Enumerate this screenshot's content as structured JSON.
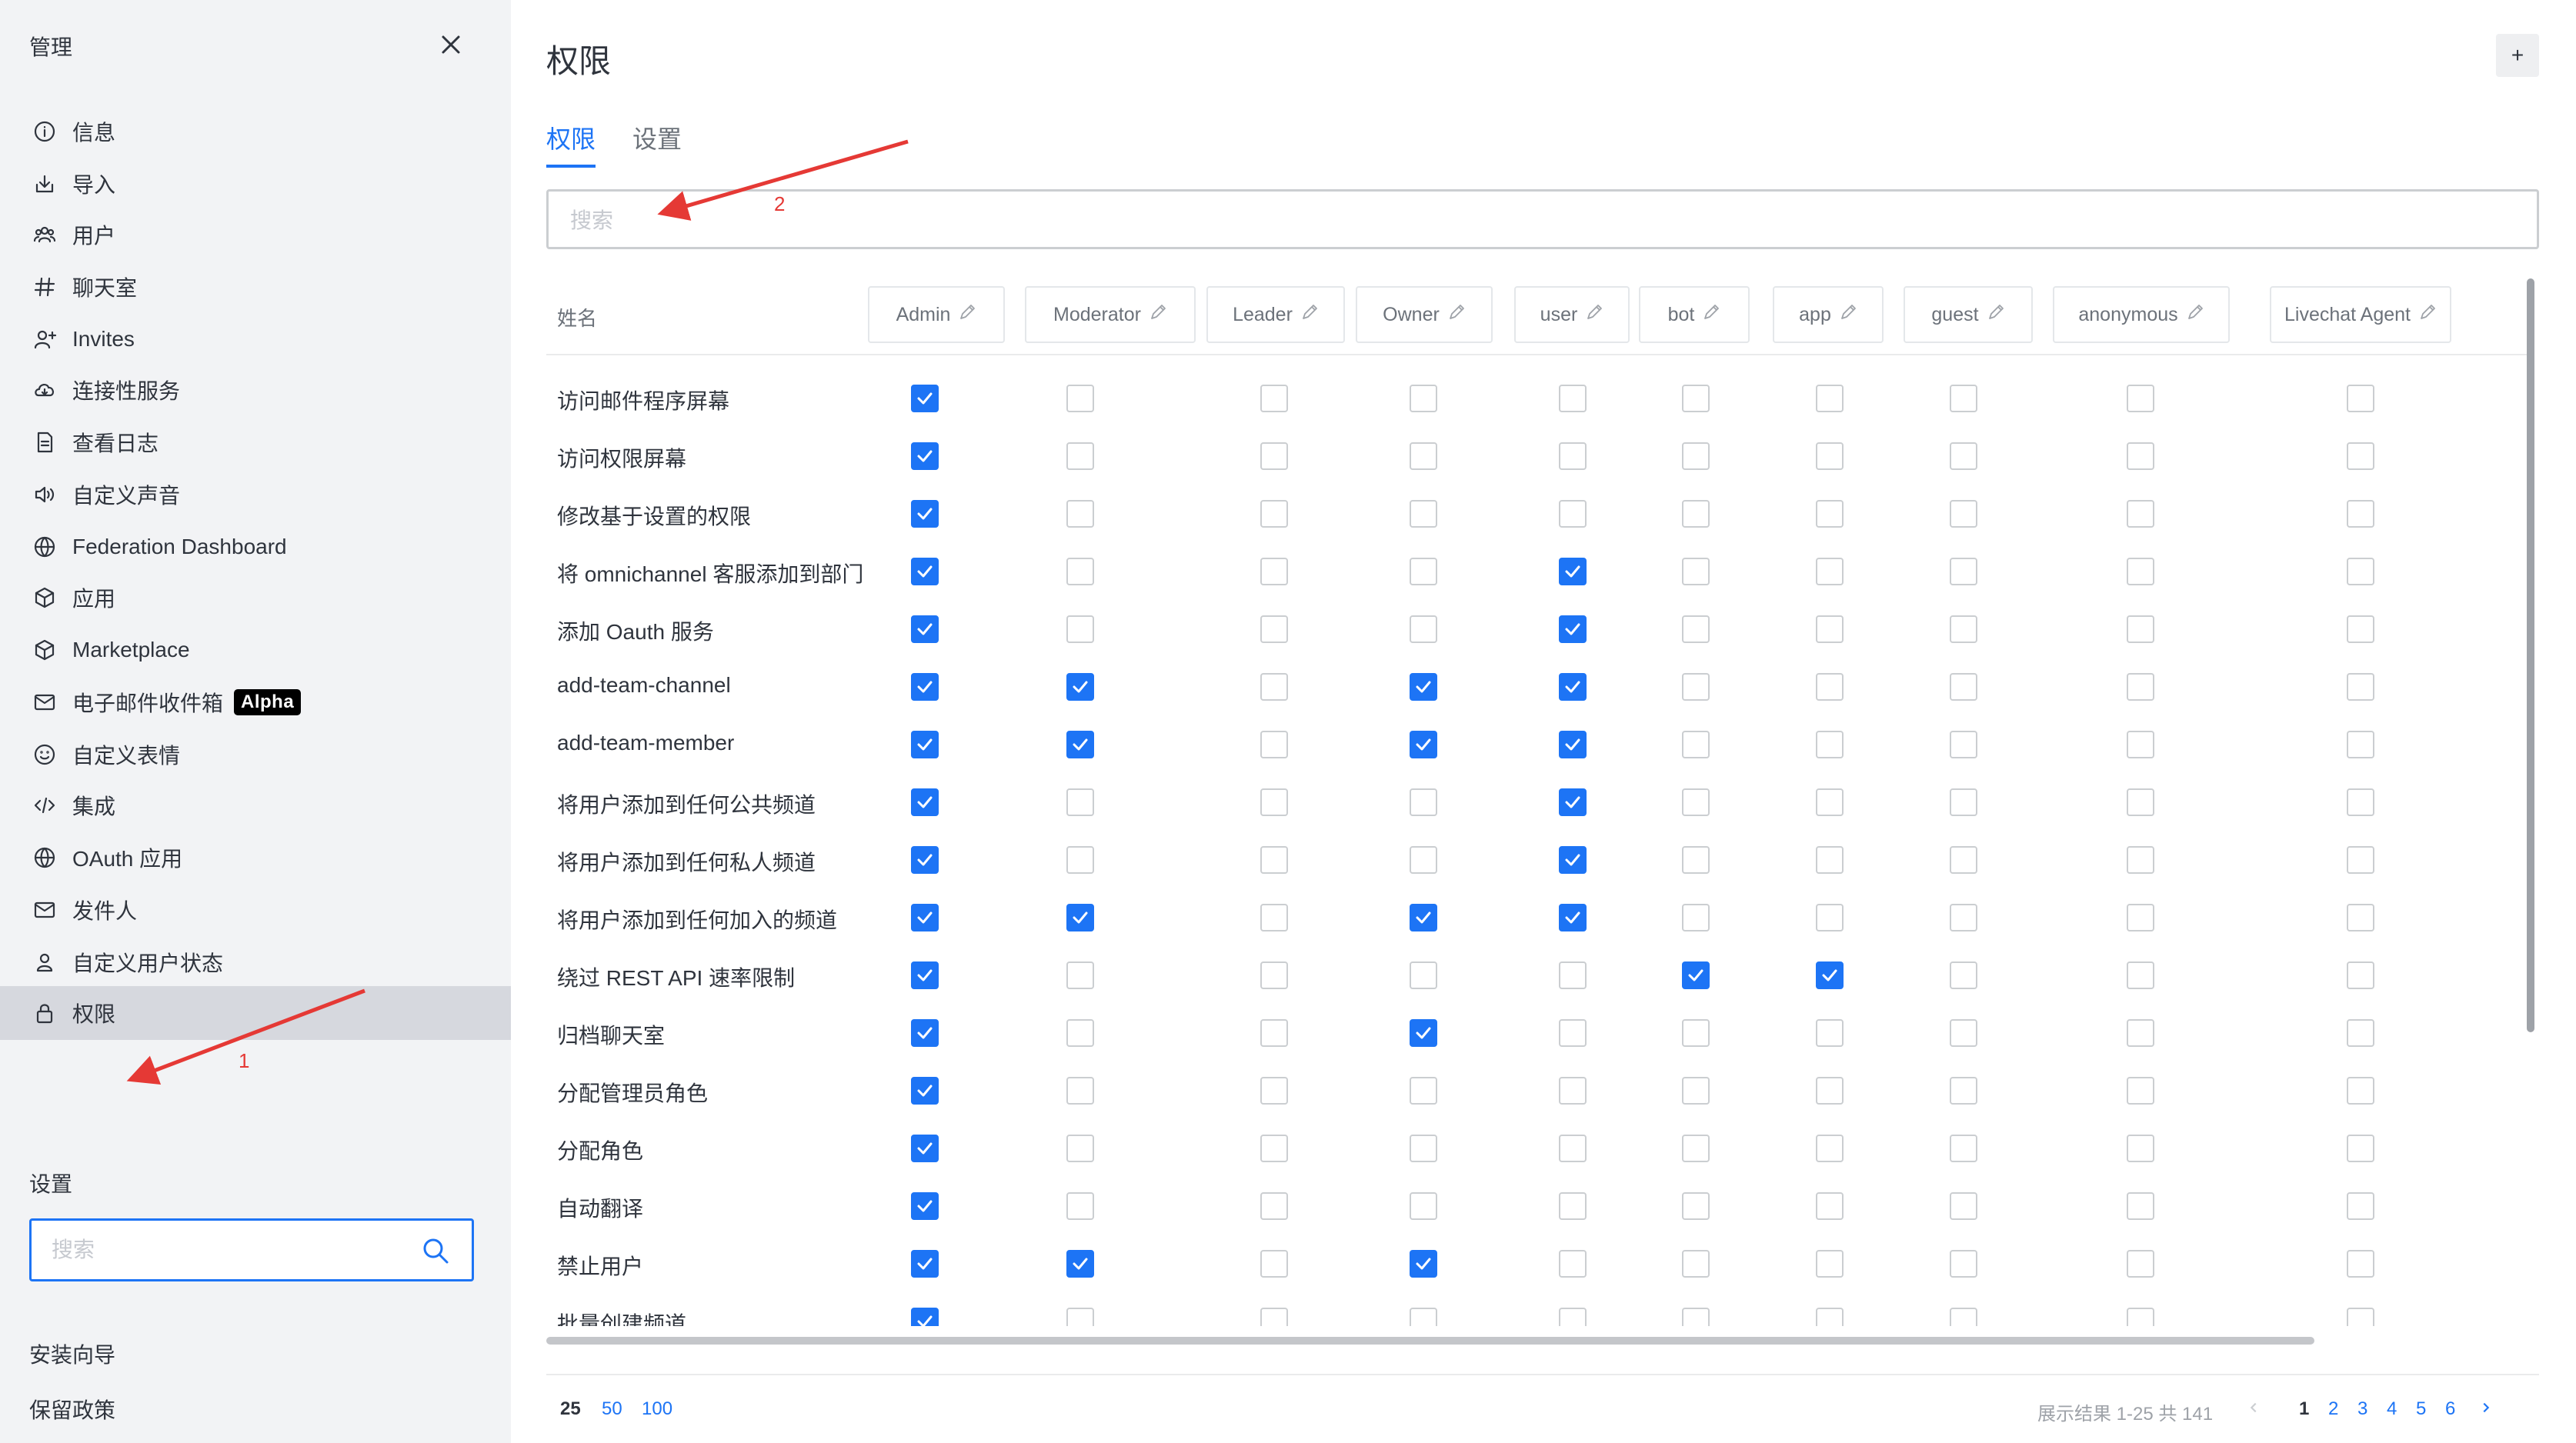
{
  "sidebar": {
    "title": "管理",
    "items": [
      {
        "label": "信息",
        "icon": "info-icon"
      },
      {
        "label": "导入",
        "icon": "import-icon"
      },
      {
        "label": "用户",
        "icon": "users-icon"
      },
      {
        "label": "聊天室",
        "icon": "hashtag-icon"
      },
      {
        "label": "Invites",
        "icon": "user-plus-icon"
      },
      {
        "label": "连接性服务",
        "icon": "cloud-icon"
      },
      {
        "label": "查看日志",
        "icon": "file-icon"
      },
      {
        "label": "自定义声音",
        "icon": "volume-icon"
      },
      {
        "label": "Federation Dashboard",
        "icon": "globe-icon"
      },
      {
        "label": "应用",
        "icon": "cube-icon"
      },
      {
        "label": "Marketplace",
        "icon": "cube-icon"
      },
      {
        "label": "电子邮件收件箱",
        "icon": "mail-icon",
        "badge": "Alpha"
      },
      {
        "label": "自定义表情",
        "icon": "emoji-icon"
      },
      {
        "label": "集成",
        "icon": "code-icon"
      },
      {
        "label": "OAuth 应用",
        "icon": "globe-icon"
      },
      {
        "label": "发件人",
        "icon": "mail-icon"
      },
      {
        "label": "自定义用户状态",
        "icon": "user-icon"
      },
      {
        "label": "权限",
        "icon": "lock-icon",
        "active": true
      }
    ],
    "settings_heading": "设置",
    "search_placeholder": "搜索",
    "settings_links": [
      "安装向导",
      "保留政策"
    ]
  },
  "main": {
    "title": "权限",
    "add_label": "+",
    "tabs": [
      {
        "label": "权限",
        "active": true
      },
      {
        "label": "设置",
        "active": false
      }
    ],
    "search_placeholder": "搜索",
    "table": {
      "name_header": "姓名",
      "roles": [
        "Admin",
        "Moderator",
        "Leader",
        "Owner",
        "user",
        "bot",
        "app",
        "guest",
        "anonymous",
        "Livechat Agent"
      ],
      "rows": [
        {
          "name": "访问邮件程序屏幕",
          "checked": [
            1,
            0,
            0,
            0,
            0,
            0,
            0,
            0,
            0,
            0
          ]
        },
        {
          "name": "访问权限屏幕",
          "checked": [
            1,
            0,
            0,
            0,
            0,
            0,
            0,
            0,
            0,
            0
          ]
        },
        {
          "name": "修改基于设置的权限",
          "checked": [
            1,
            0,
            0,
            0,
            0,
            0,
            0,
            0,
            0,
            0
          ]
        },
        {
          "name": "将 omnichannel 客服添加到部门",
          "checked": [
            1,
            0,
            0,
            0,
            1,
            0,
            0,
            0,
            0,
            0
          ]
        },
        {
          "name": "添加 Oauth 服务",
          "checked": [
            1,
            0,
            0,
            0,
            1,
            0,
            0,
            0,
            0,
            0
          ]
        },
        {
          "name": "add-team-channel",
          "checked": [
            1,
            1,
            0,
            1,
            1,
            0,
            0,
            0,
            0,
            0
          ]
        },
        {
          "name": "add-team-member",
          "checked": [
            1,
            1,
            0,
            1,
            1,
            0,
            0,
            0,
            0,
            0
          ]
        },
        {
          "name": "将用户添加到任何公共频道",
          "checked": [
            1,
            0,
            0,
            0,
            1,
            0,
            0,
            0,
            0,
            0
          ]
        },
        {
          "name": "将用户添加到任何私人频道",
          "checked": [
            1,
            0,
            0,
            0,
            1,
            0,
            0,
            0,
            0,
            0
          ]
        },
        {
          "name": "将用户添加到任何加入的频道",
          "checked": [
            1,
            1,
            0,
            1,
            1,
            0,
            0,
            0,
            0,
            0
          ]
        },
        {
          "name": "绕过 REST API 速率限制",
          "checked": [
            1,
            0,
            0,
            0,
            0,
            1,
            1,
            0,
            0,
            0
          ]
        },
        {
          "name": "归档聊天室",
          "checked": [
            1,
            0,
            0,
            1,
            0,
            0,
            0,
            0,
            0,
            0
          ]
        },
        {
          "name": "分配管理员角色",
          "checked": [
            1,
            0,
            0,
            0,
            0,
            0,
            0,
            0,
            0,
            0
          ]
        },
        {
          "name": "分配角色",
          "checked": [
            1,
            0,
            0,
            0,
            0,
            0,
            0,
            0,
            0,
            0
          ]
        },
        {
          "name": "自动翻译",
          "checked": [
            1,
            0,
            0,
            0,
            0,
            0,
            0,
            0,
            0,
            0
          ]
        },
        {
          "name": "禁止用户",
          "checked": [
            1,
            1,
            0,
            1,
            0,
            0,
            0,
            0,
            0,
            0
          ]
        },
        {
          "name": "批量创建频道",
          "checked": [
            1,
            0,
            0,
            0,
            0,
            0,
            0,
            0,
            0,
            0
          ]
        }
      ]
    },
    "pagination": {
      "items_per_page": [
        "25",
        "50",
        "100"
      ],
      "selected_items_per_page": "25",
      "result_text": "展示结果 1-25 共 141",
      "pages": [
        "1",
        "2",
        "3",
        "4",
        "5",
        "6"
      ],
      "current_page": "1"
    }
  },
  "annotations": [
    {
      "label": "1",
      "color": "#e53935"
    },
    {
      "label": "2",
      "color": "#e53935"
    }
  ],
  "colors": {
    "accent": "#1d74f5",
    "sidebar_bg": "#f2f3f5",
    "active_item_bg": "#d6d8de",
    "annotation": "#e53935"
  }
}
